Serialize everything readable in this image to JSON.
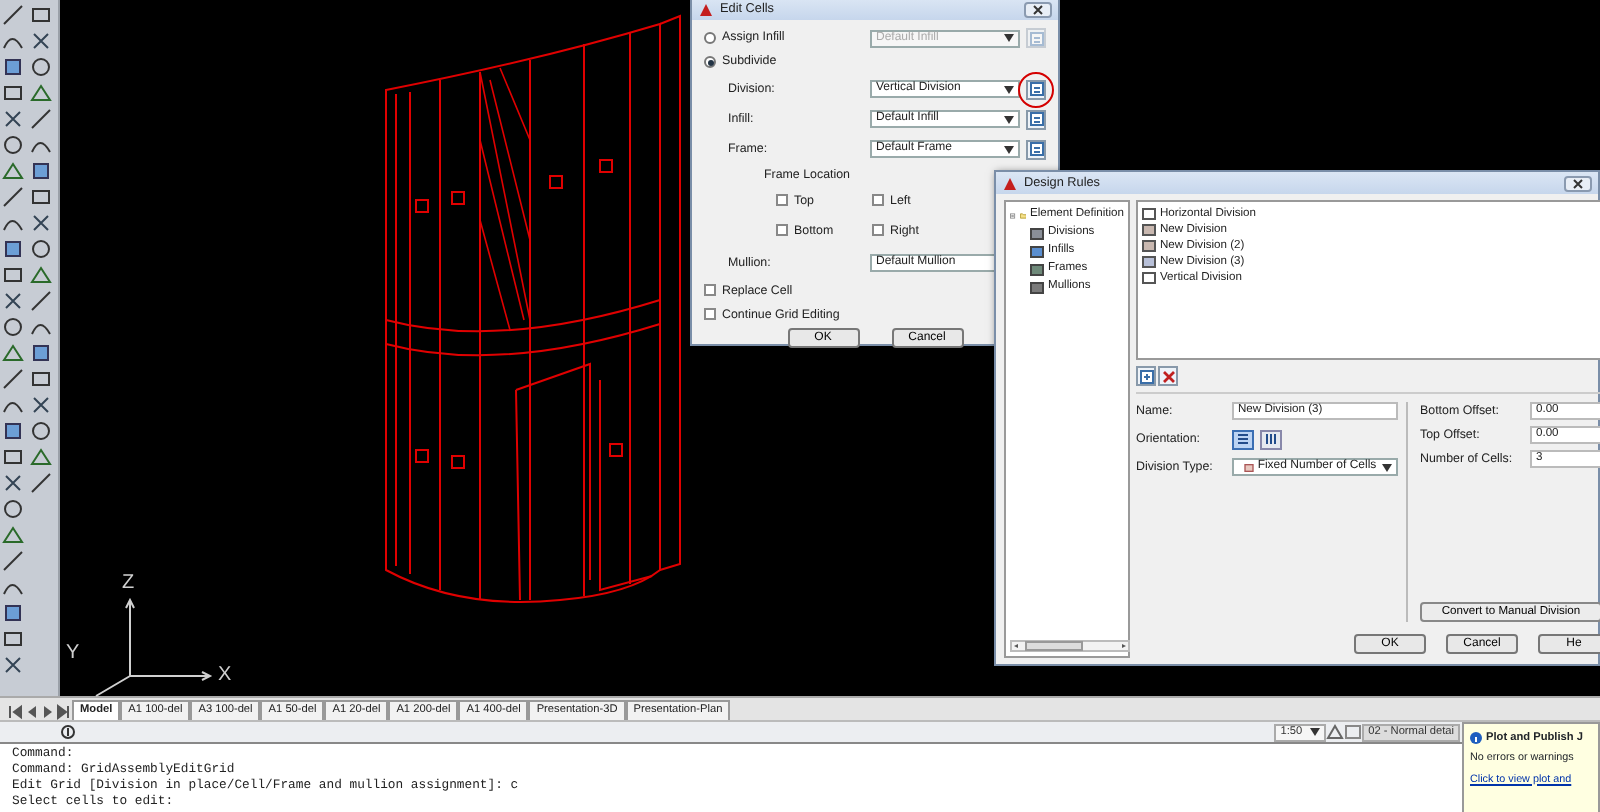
{
  "edit_cells": {
    "title": "Edit Cells",
    "assign_infill": {
      "label": "Assign Infill",
      "selected": false,
      "value": "Default Infill",
      "disabled": true
    },
    "subdivide": {
      "label": "Subdivide",
      "selected": true
    },
    "rows": [
      {
        "label": "Division:",
        "value": "Vertical Division",
        "highlighted": true
      },
      {
        "label": "Infill:",
        "value": "Default Infill",
        "highlighted": false
      },
      {
        "label": "Frame:",
        "value": "Default Frame",
        "highlighted": false
      }
    ],
    "frame_location": {
      "title": "Frame Location",
      "options": [
        {
          "label": "Top",
          "checked": false
        },
        {
          "label": "Left",
          "checked": false
        },
        {
          "label": "Bottom",
          "checked": false
        },
        {
          "label": "Right",
          "checked": false
        }
      ]
    },
    "mullion": {
      "label": "Mullion:",
      "value": "Default Mullion"
    },
    "checkboxes": [
      {
        "label": "Replace Cell",
        "checked": false
      },
      {
        "label": "Continue Grid Editing",
        "checked": false
      }
    ],
    "buttons": [
      "OK",
      "Cancel"
    ]
  },
  "design_rules": {
    "title": "Design Rules",
    "tree": [
      {
        "label": "Element Definition",
        "expanded": true,
        "children": [
          {
            "label": "Divisions"
          },
          {
            "label": "Infills"
          },
          {
            "label": "Frames"
          },
          {
            "label": "Mullions"
          }
        ]
      }
    ],
    "list": [
      {
        "label": "Horizontal Division",
        "selected": false
      },
      {
        "label": "New Division",
        "selected": false
      },
      {
        "label": "New Division (2)",
        "selected": false
      },
      {
        "label": "New Division (3)",
        "selected": false
      },
      {
        "label": "Vertical Division",
        "selected": false
      }
    ],
    "name": {
      "label": "Name:",
      "value": "New Division (3)"
    },
    "orientation": {
      "label": "Orientation:",
      "options": [
        {
          "kind": "horizontal",
          "selected": true
        },
        {
          "kind": "vertical",
          "selected": false
        }
      ]
    },
    "division_type": {
      "label": "Division Type:",
      "value": "Fixed Number of Cells"
    },
    "offsets": [
      {
        "label": "Bottom Offset:",
        "value": "0.00"
      },
      {
        "label": "Top Offset:",
        "value": "0.00"
      },
      {
        "label": "Number of Cells:",
        "value": "3"
      }
    ],
    "convert_button": "Convert to Manual Division",
    "buttons": [
      "OK",
      "Cancel",
      "He"
    ]
  },
  "ucs": {
    "z": "Z",
    "y": "Y",
    "x": "X"
  },
  "layout_tabs": [
    {
      "label": "Model",
      "selected": true
    },
    {
      "label": "A1 100-del",
      "selected": false
    },
    {
      "label": "A3 100-del",
      "selected": false
    },
    {
      "label": "A1 50-del",
      "selected": false
    },
    {
      "label": "A1 20-del",
      "selected": false
    },
    {
      "label": "A1 200-del",
      "selected": false
    },
    {
      "label": "A1 400-del",
      "selected": false
    },
    {
      "label": "Presentation-3D",
      "selected": false
    },
    {
      "label": "Presentation-Plan",
      "selected": false
    }
  ],
  "status_bar": {
    "scale": "1:50",
    "detail": "02 - Normal detai"
  },
  "command_lines": [
    "Command:",
    "Command: GridAssemblyEditGrid",
    "Edit Grid [Division in place/Cell/Frame and mullion assignment]: c",
    "Select cells to edit:"
  ],
  "notification": {
    "title": "Plot and Publish J",
    "message": "No errors or warnings",
    "link": "Click to view plot and"
  }
}
